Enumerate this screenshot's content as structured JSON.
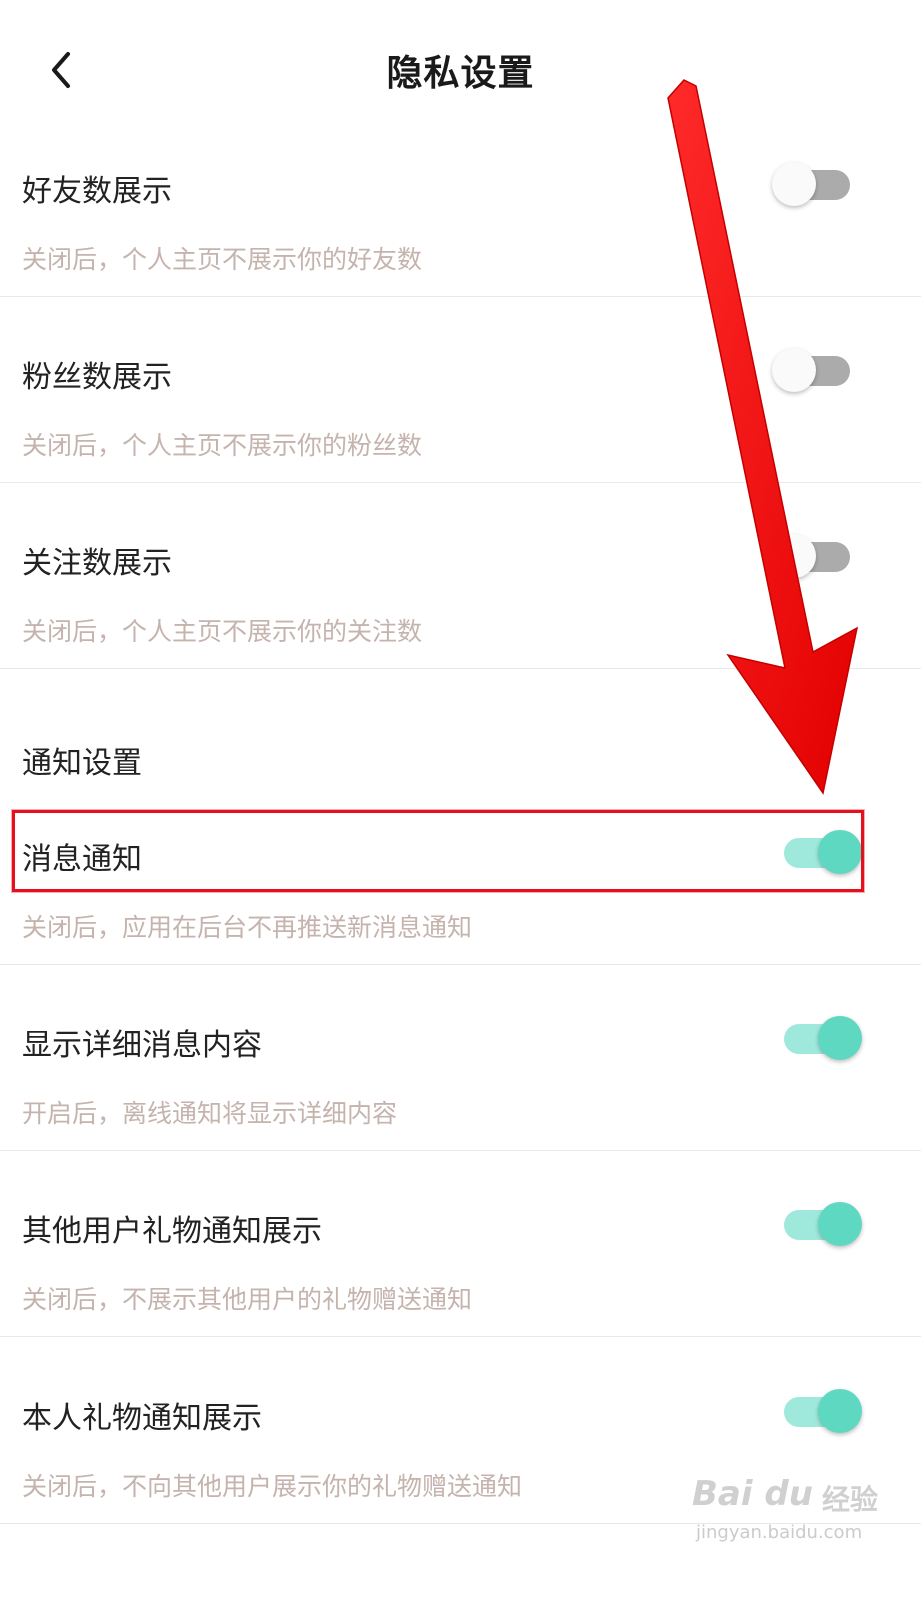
{
  "header": {
    "title": "隐私设置",
    "back_icon": "chevron-left-icon"
  },
  "privacy_items": [
    {
      "title": "好友数展示",
      "desc": "关闭后，个人主页不展示你的好友数",
      "enabled": false
    },
    {
      "title": "粉丝数展示",
      "desc": "关闭后，个人主页不展示你的粉丝数",
      "enabled": false
    },
    {
      "title": "关注数展示",
      "desc": "关闭后，个人主页不展示你的关注数",
      "enabled": false
    }
  ],
  "notification_section": {
    "title": "通知设置",
    "items": [
      {
        "title": "消息通知",
        "desc": "关闭后，应用在后台不再推送新消息通知",
        "enabled": true
      },
      {
        "title": "显示详细消息内容",
        "desc": "开启后，离线通知将显示详细内容",
        "enabled": true
      },
      {
        "title": "其他用户礼物通知展示",
        "desc": "关闭后，不展示其他用户的礼物赠送通知",
        "enabled": true
      },
      {
        "title": "本人礼物通知展示",
        "desc": "关闭后，不向其他用户展示你的礼物赠送通知",
        "enabled": true
      }
    ]
  },
  "colors": {
    "toggle_on_knob": "#5fd8c2",
    "toggle_on_track": "#9fe9dc",
    "toggle_off_track": "#ababab",
    "annotation_red": "#e4101c",
    "desc_text": "#c5b3ad"
  },
  "watermark": {
    "logo": "Bai du",
    "label": "经验",
    "url": "jingyan.baidu.com"
  }
}
